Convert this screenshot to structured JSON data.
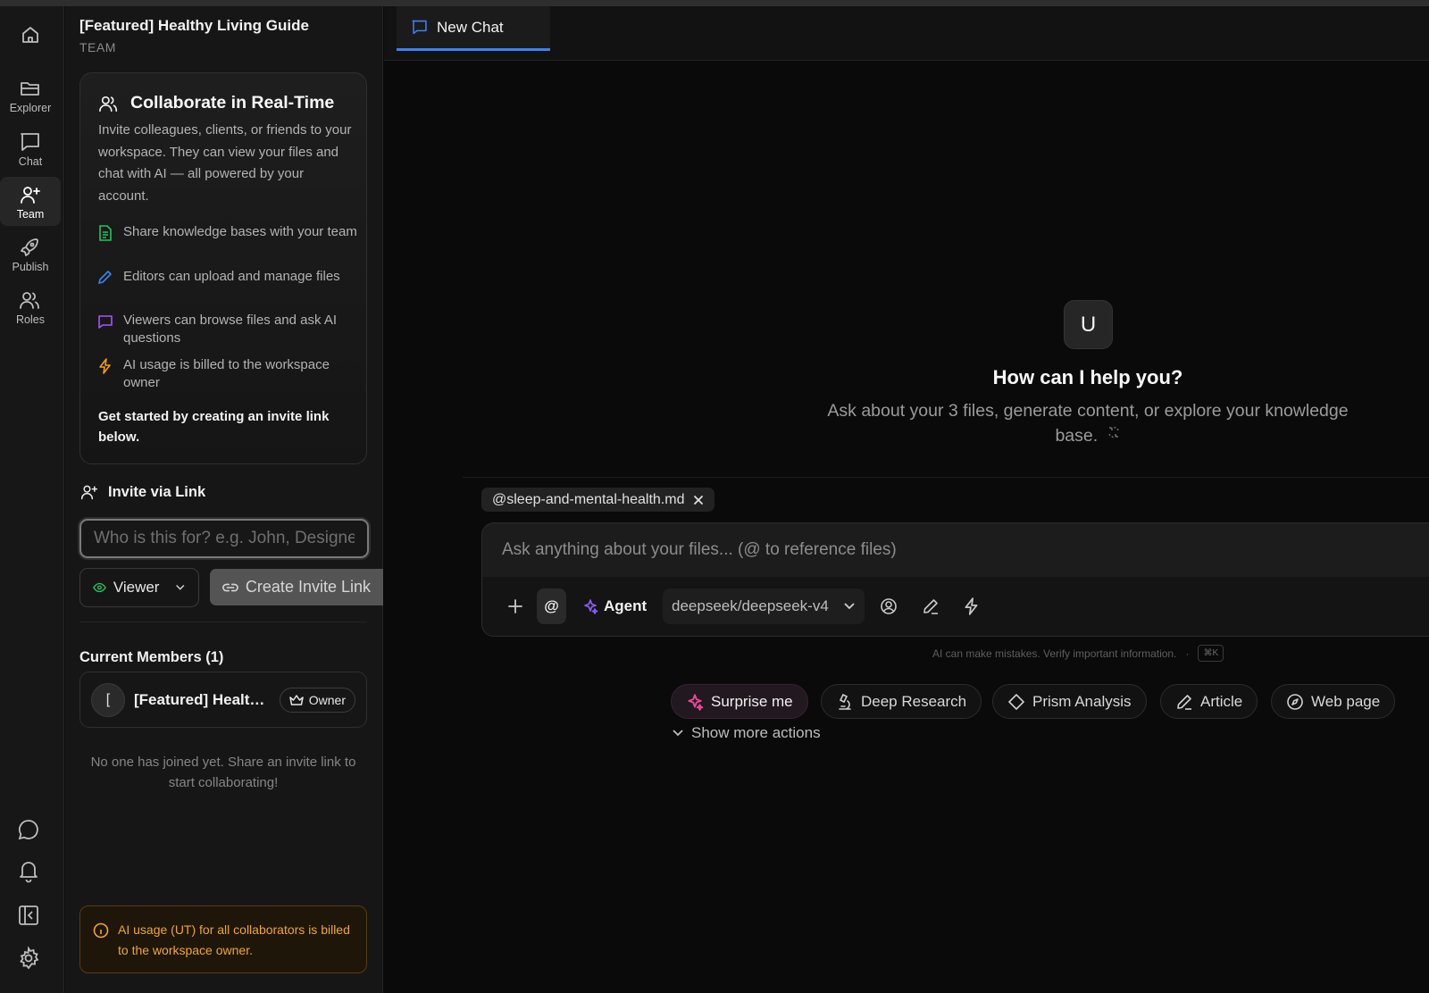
{
  "rail": {
    "items": [
      {
        "label": ""
      },
      {
        "label": "Explorer"
      },
      {
        "label": "Chat"
      },
      {
        "label": "Team"
      },
      {
        "label": "Publish"
      },
      {
        "label": "Roles"
      }
    ]
  },
  "workspace": {
    "title": "[Featured] Healthy Living Guide",
    "subtitle": "TEAM"
  },
  "collab": {
    "title": "Collaborate in Real-Time",
    "description": "Invite colleagues, clients, or friends to your workspace. They can view your files and chat with AI — all powered by your account.",
    "features": [
      {
        "text": "Share knowledge bases with your team",
        "icon": "document-icon",
        "color": "#22c55e"
      },
      {
        "text": "Editors can upload and manage files",
        "icon": "pencil-icon",
        "color": "#3b82f6"
      },
      {
        "text": "Viewers can browse files and ask AI questions",
        "icon": "message-icon",
        "color": "#a855f7"
      },
      {
        "text": "AI usage is billed to the workspace owner",
        "icon": "bolt-icon",
        "color": "#f59e0b"
      }
    ],
    "cta": "Get started by creating an invite link below."
  },
  "invite": {
    "title": "Invite via Link",
    "placeholder": "Who is this for? e.g. John, Designer",
    "role": "Viewer",
    "create_label": "Create Invite Link"
  },
  "members": {
    "title": "Current Members (1)",
    "list": [
      {
        "initial": "[",
        "name": "[Featured] Healthy Living Guide",
        "badge": "Owner"
      }
    ],
    "empty_note": "No one has joined yet. Share an invite link to start collaborating!"
  },
  "billing_warning": "AI usage (UT) for all collaborators is billed to the workspace owner.",
  "tabs": [
    {
      "label": "New Chat"
    }
  ],
  "chat": {
    "avatar": "U",
    "title": "How can I help you?",
    "subtitle": "Ask about your 3 files, generate content, or explore your knowledge base.",
    "file_chip": "@sleep-and-mental-health.md",
    "input_placeholder": "Ask anything about your files... (@ to reference files)",
    "at_label": "@",
    "agent_label": "Agent",
    "model": "deepseek/deepseek-v4",
    "disclaimer": "AI can make mistakes. Verify important information.",
    "shortcut": "⌘K"
  },
  "actions": [
    {
      "label": "Surprise me",
      "icon": "sparkles-icon"
    },
    {
      "label": "Deep Research",
      "icon": "microscope-icon"
    },
    {
      "label": "Prism Analysis",
      "icon": "diamond-icon"
    },
    {
      "label": "Article",
      "icon": "pen-icon"
    },
    {
      "label": "Web page",
      "icon": "compass-icon"
    }
  ],
  "show_more": "Show more actions",
  "colors": {
    "accent": "#3b82f6",
    "warning": "#f0a530",
    "agent": "#8b5cf6",
    "surprise": "#ec4899",
    "viewer_eye": "#22c55e"
  }
}
